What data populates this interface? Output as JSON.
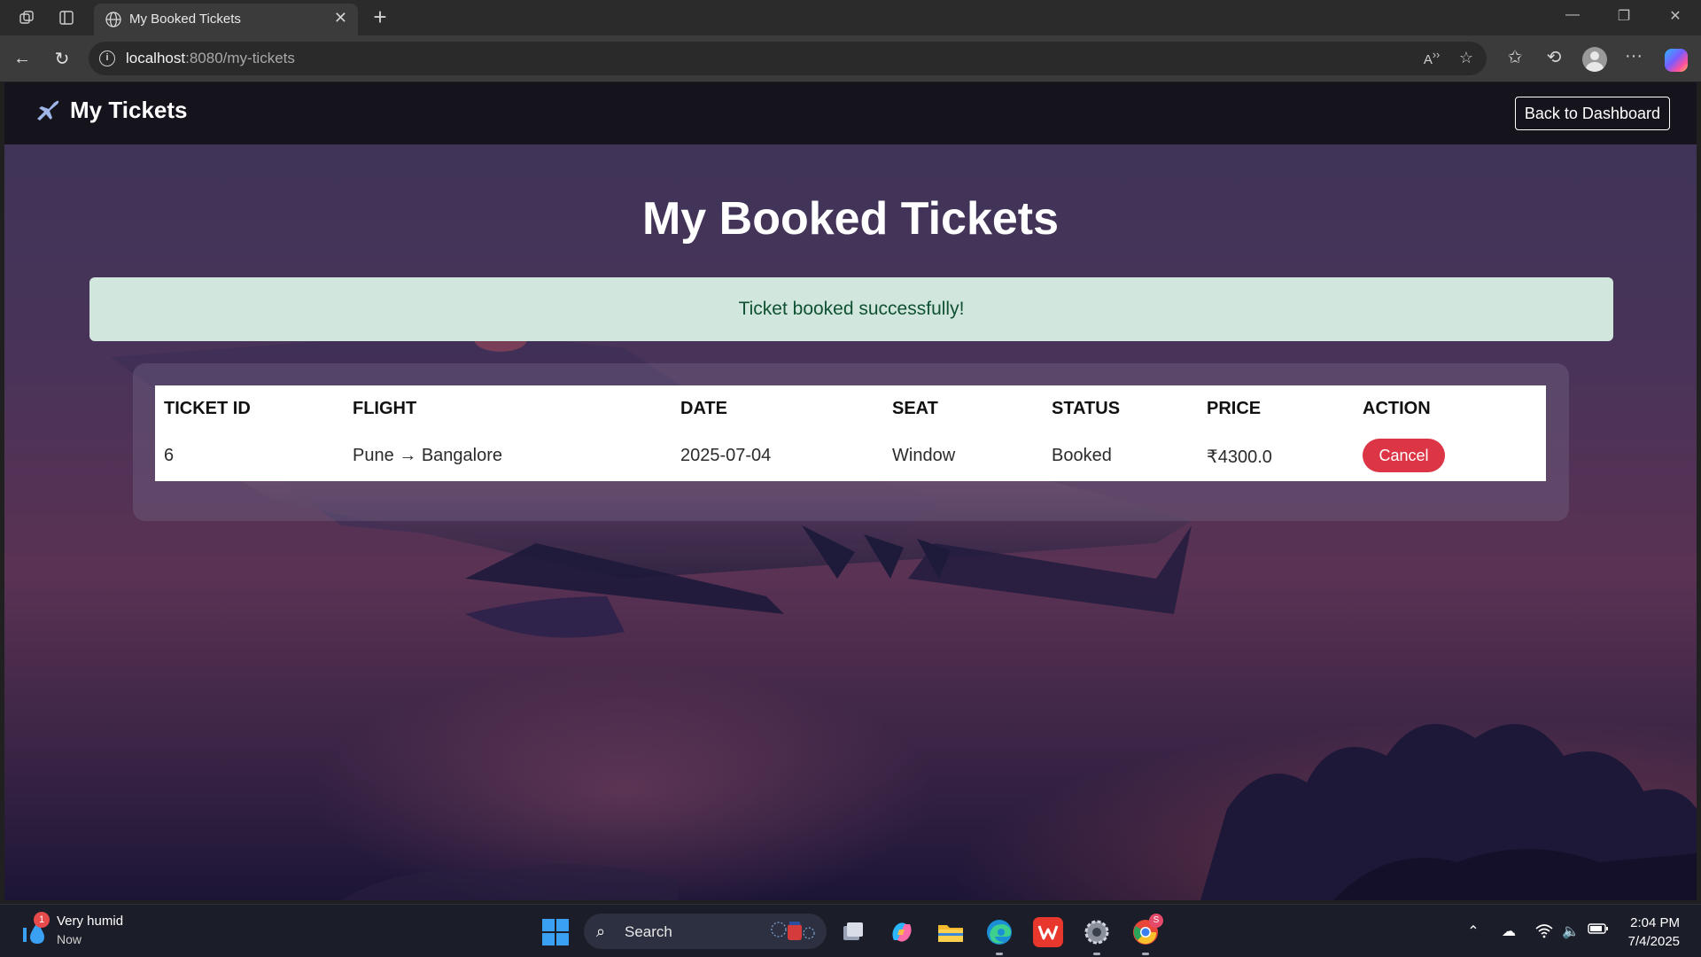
{
  "browser": {
    "tab_title": "My Booked Tickets",
    "url_host": "localhost",
    "url_rest": ":8080/my-tickets"
  },
  "site": {
    "brand": "My Tickets",
    "back_button": "Back to Dashboard",
    "heading": "My Booked Tickets",
    "alert": "Ticket booked successfully!",
    "table": {
      "headers": [
        "TICKET ID",
        "FLIGHT",
        "DATE",
        "SEAT",
        "STATUS",
        "PRICE",
        "ACTION"
      ],
      "rows": [
        {
          "ticket_id": "6",
          "flight": "Pune → Bangalore",
          "date": "2025-07-04",
          "seat": "Window",
          "status": "Booked",
          "price": "₹4300.0",
          "action": "Cancel"
        }
      ]
    }
  },
  "taskbar": {
    "weather_title": "Very humid",
    "weather_sub": "Now",
    "weather_badge": "1",
    "search_label": "Search",
    "chrome_badge": "S",
    "time": "2:04 PM",
    "date": "7/4/2025"
  },
  "colors": {
    "alert_bg": "#d1e7dd",
    "alert_text": "#0f5132",
    "cancel": "#dc3545",
    "site_nav": "#15131b"
  },
  "icons": [
    "collections-icon",
    "sidebar-icon",
    "globe-icon",
    "close-icon",
    "plus-icon",
    "back-icon",
    "refresh-icon",
    "info-icon",
    "read-aloud-icon",
    "star-icon",
    "favorites-icon",
    "history-icon",
    "profile-icon",
    "more-icon",
    "copilot-icon",
    "airplane-icon",
    "windows-start-icon",
    "search-icon",
    "wifi-icon",
    "volume-icon",
    "battery-icon"
  ]
}
